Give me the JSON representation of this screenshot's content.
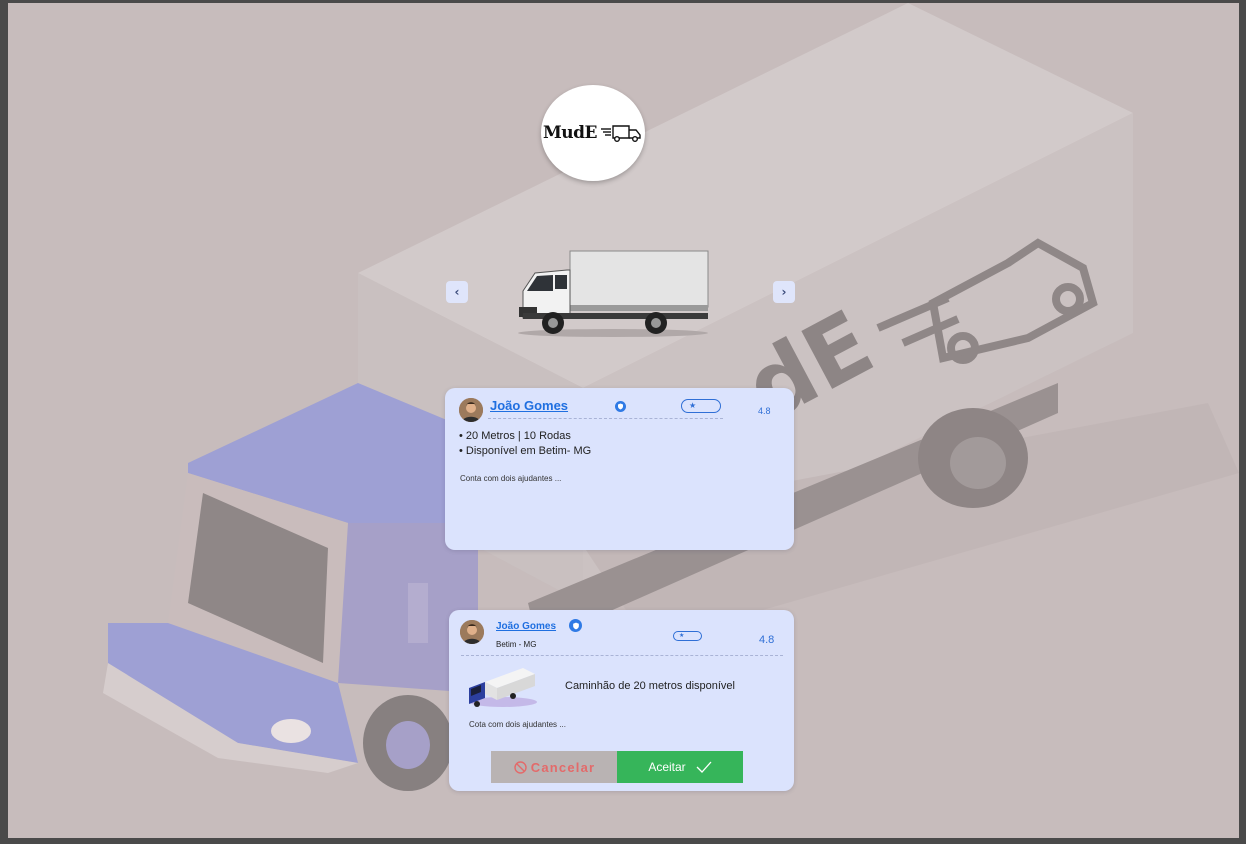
{
  "app": {
    "logo_text": "MudE"
  },
  "carousel": {
    "prev_label": "‹",
    "next_label": "›"
  },
  "card_primary": {
    "name": "João Gomes",
    "rating": "4.8",
    "details": [
      "• 20 Metros | 10 Rodas",
      "• Disponível em Betim- MG"
    ],
    "note": "Conta com dois ajudantes ..."
  },
  "card_request": {
    "name": "João Gomes",
    "location": "Betim - MG",
    "rating": "4.8",
    "headline": "Caminhão de 20 metros disponível",
    "note": "Cota com dois ajudantes ...",
    "cancel_label": "Cancelar",
    "accept_label": "Aceitar"
  },
  "colors": {
    "accent_blue": "#1f6fe0",
    "card_bg": "#dbe3fd",
    "accept_green": "#36b55a",
    "cancel_red": "#e36a6a"
  }
}
